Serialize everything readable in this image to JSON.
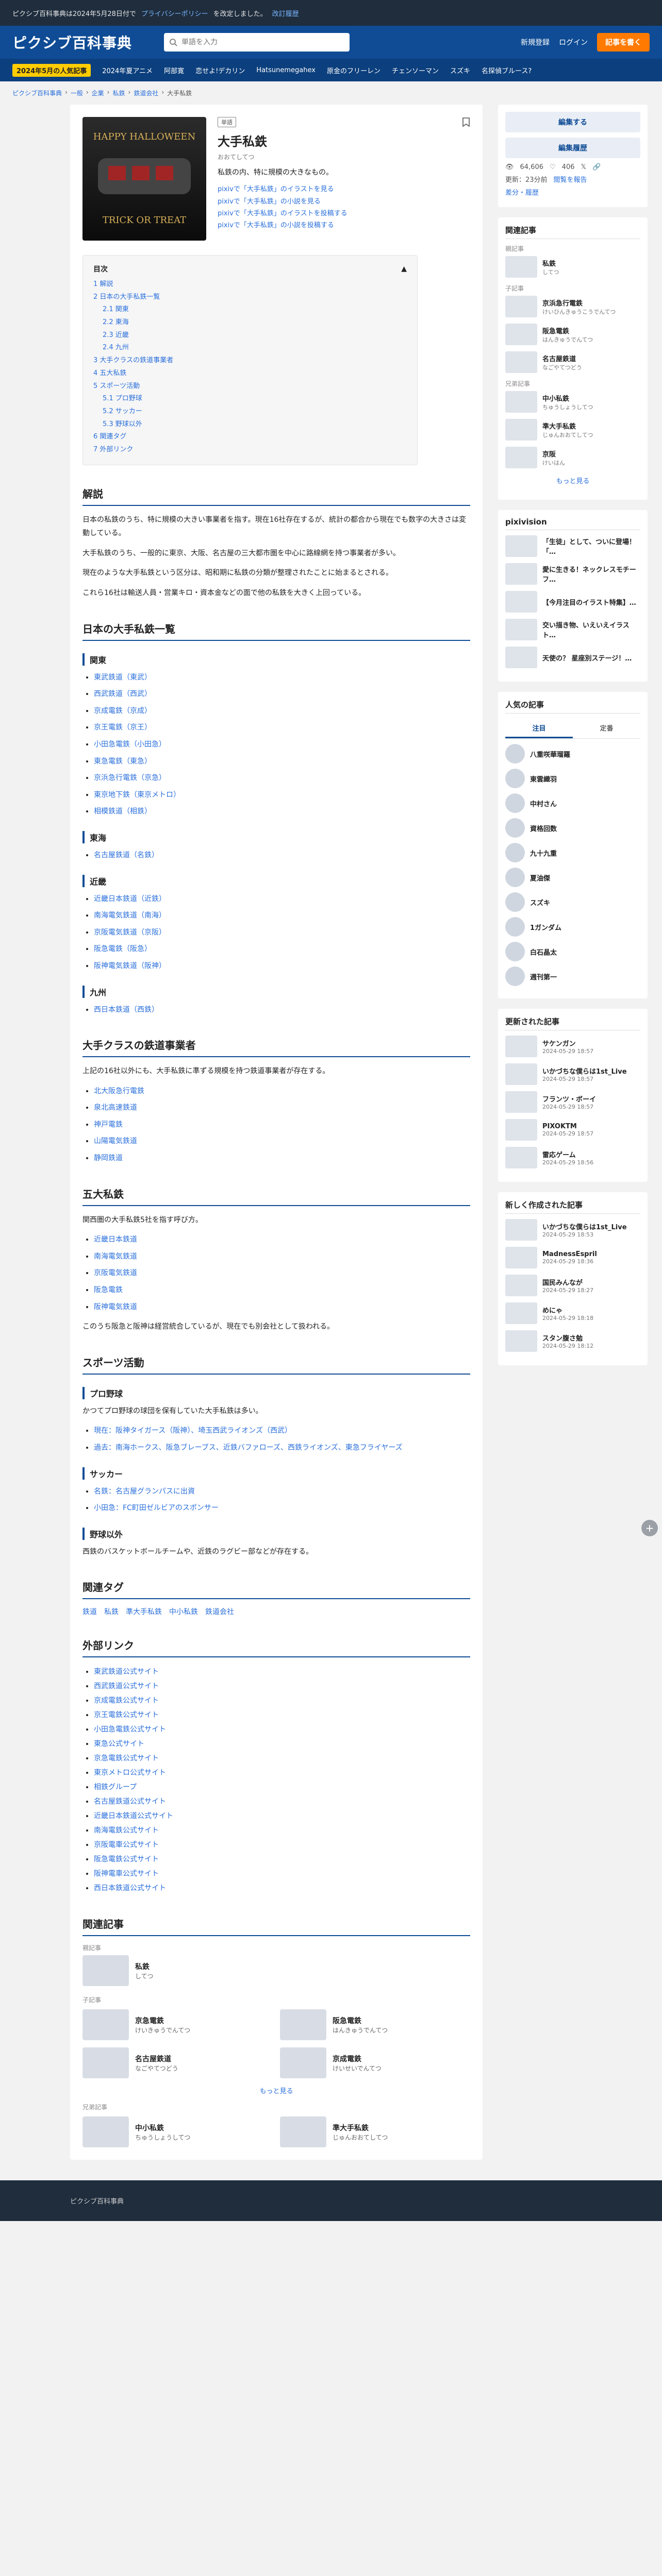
{
  "notice": {
    "text": "ピクシブ百科事典は2024年5月28日付で",
    "link": "プライバシーポリシー",
    "text2": "を改定しました。",
    "link2": "改訂履歴"
  },
  "header": {
    "logo": "ピクシブ百科事典",
    "search_placeholder": "単語を入力",
    "links": [
      "新規登録",
      "ログイン"
    ],
    "cta": "記事を書く",
    "trend_tag": "2024年5月の人気記事",
    "trends": [
      "2024年夏アニメ",
      "阿部寛",
      "恋せよ!デカリン",
      "Hatsunemegahex",
      "原金のフリーレン",
      "チェンソーマン",
      "スズキ",
      "名探偵ブルース?"
    ]
  },
  "breadcrumb": [
    "ピクシブ百科事典",
    "一般",
    "企業",
    "私鉄",
    "鉄道会社",
    "大手私鉄"
  ],
  "article": {
    "badge": "単語",
    "title": "大手私鉄",
    "reading": "おおてしてつ",
    "lead": "私鉄の内、特に規模の大きなもの。",
    "pixiv_links": [
      "pixivで「大手私鉄」のイラストを見る",
      "pixivで「大手私鉄」の小説を見る",
      "pixivで「大手私鉄」のイラストを投稿する",
      "pixivで「大手私鉄」の小説を投稿する"
    ],
    "thumb_text_top": "HAPPY HALLOWEEN",
    "thumb_text_bottom": "TRICK OR TREAT"
  },
  "toc": {
    "heading": "目次",
    "items": [
      {
        "label": "1 解説",
        "sub": false
      },
      {
        "label": "2 日本の大手私鉄一覧",
        "sub": false
      },
      {
        "label": "2.1 関東",
        "sub": true
      },
      {
        "label": "2.2 東海",
        "sub": true
      },
      {
        "label": "2.3 近畿",
        "sub": true
      },
      {
        "label": "2.4 九州",
        "sub": true
      },
      {
        "label": "3 大手クラスの鉄道事業者",
        "sub": false
      },
      {
        "label": "4 五大私鉄",
        "sub": false
      },
      {
        "label": "5 スポーツ活動",
        "sub": false
      },
      {
        "label": "5.1 プロ野球",
        "sub": true
      },
      {
        "label": "5.2 サッカー",
        "sub": true
      },
      {
        "label": "5.3 野球以外",
        "sub": true
      },
      {
        "label": "6 関連タグ",
        "sub": false
      },
      {
        "label": "7 外部リンク",
        "sub": false
      }
    ]
  },
  "sections": {
    "kaisetsu": {
      "title": "解説",
      "paras": [
        "日本の私鉄のうち、特に規模の大きい事業者を指す。現在16社存在するが、統計の都合から現在でも数字の大きさは変動している。",
        "大手私鉄のうち、一般的に東京、大阪、名古屋の三大都市圏を中心に路線網を持つ事業者が多い。",
        "現在のような大手私鉄という区分は、昭和期に私鉄の分類が整理されたことに始まるとされる。",
        "これら16社は輸送人員・営業キロ・資本金などの面で他の私鉄を大きく上回っている。"
      ]
    },
    "list": {
      "title": "日本の大手私鉄一覧",
      "kanto_title": "関東",
      "kanto": [
        "東武鉄道（東武）",
        "西武鉄道（西武）",
        "京成電鉄（京成）",
        "京王電鉄（京王）",
        "小田急電鉄（小田急）",
        "東急電鉄（東急）",
        "京浜急行電鉄（京急）",
        "東京地下鉄（東京メトロ）",
        "相模鉄道（相鉄）"
      ],
      "tokai_title": "東海",
      "tokai": [
        "名古屋鉄道（名鉄）"
      ],
      "kinki_title": "近畿",
      "kinki": [
        "近畿日本鉄道（近鉄）",
        "南海電気鉄道（南海）",
        "京阪電気鉄道（京阪）",
        "阪急電鉄（阪急）",
        "阪神電気鉄道（阪神）"
      ],
      "kyushu_title": "九州",
      "kyushu": [
        "西日本鉄道（西鉄）"
      ]
    },
    "class": {
      "title": "大手クラスの鉄道事業者",
      "para": "上記の16社以外にも、大手私鉄に準ずる規模を持つ鉄道事業者が存在する。",
      "items": [
        "北大阪急行電鉄",
        "泉北高速鉄道",
        "神戸電鉄",
        "山陽電気鉄道",
        "静岡鉄道"
      ]
    },
    "five": {
      "title": "五大私鉄",
      "para": "関西圏の大手私鉄5社を指す呼び方。",
      "items": [
        "近畿日本鉄道",
        "南海電気鉄道",
        "京阪電気鉄道",
        "阪急電鉄",
        "阪神電気鉄道"
      ],
      "note": "このうち阪急と阪神は経営統合しているが、現在でも別会社として扱われる。"
    },
    "sports": {
      "title": "スポーツ活動",
      "baseball_title": "プロ野球",
      "baseball_para": "かつてプロ野球の球団を保有していた大手私鉄は多い。",
      "baseball_items": [
        "現在：阪神タイガース（阪神）、埼玉西武ライオンズ（西武）",
        "過去：南海ホークス、阪急ブレーブス、近鉄バファローズ、西鉄ライオンズ、東急フライヤーズ"
      ],
      "soccer_title": "サッカー",
      "soccer_items": [
        "名鉄：名古屋グランパスに出資",
        "小田急：FC町田ゼルビアのスポンサー"
      ],
      "other_title": "野球以外",
      "other_para": "西鉄のバスケットボールチームや、近鉄のラグビー部などが存在する。"
    },
    "tags": {
      "title": "関連タグ",
      "items": [
        "鉄道",
        "私鉄",
        "準大手私鉄",
        "中小私鉄",
        "鉄道会社"
      ]
    },
    "links": {
      "title": "外部リンク",
      "items": [
        "東武鉄道公式サイト",
        "西武鉄道公式サイト",
        "京成電鉄公式サイト",
        "京王電鉄公式サイト",
        "小田急電鉄公式サイト",
        "東急公式サイト",
        "京急電鉄公式サイト",
        "東京メトロ公式サイト",
        "相鉄グループ",
        "名古屋鉄道公式サイト",
        "近畿日本鉄道公式サイト",
        "南海電鉄公式サイト",
        "京阪電車公式サイト",
        "阪急電鉄公式サイト",
        "阪神電車公式サイト",
        "西日本鉄道公式サイト"
      ]
    }
  },
  "related_bottom": {
    "title": "関連記事",
    "sub": "親記事",
    "parent": {
      "name": "私鉄",
      "desc": "してつ"
    },
    "children_title": "子記事",
    "children": [
      {
        "name": "京急電鉄",
        "desc": "けいきゅうでんてつ"
      },
      {
        "name": "阪急電鉄",
        "desc": "はんきゅうでんてつ"
      },
      {
        "name": "名古屋鉄道",
        "desc": "なごやてつどう"
      },
      {
        "name": "京成電鉄",
        "desc": "けいせいでんてつ"
      }
    ],
    "more": "もっと見る",
    "sibling_title": "兄弟記事",
    "siblings": [
      {
        "name": "中小私鉄",
        "desc": "ちゅうしょうしてつ"
      },
      {
        "name": "準大手私鉄",
        "desc": "じゅんおおてしてつ"
      }
    ]
  },
  "sidebar": {
    "edit": "編集する",
    "edit_log": "編集履歴",
    "views": "64,606",
    "likes": "406",
    "updated": "更新：23分前",
    "diff": "閲覧を報告",
    "history_link": "差分・履歴",
    "related_title": "関連記事",
    "parent_label": "親記事",
    "parent": {
      "title": "私鉄",
      "sub": "してつ"
    },
    "children_label": "子記事",
    "children": [
      {
        "title": "京浜急行電鉄",
        "sub": "けいひんきゅうこうでんてつ"
      },
      {
        "title": "阪急電鉄",
        "sub": "はんきゅうでんてつ"
      },
      {
        "title": "名古屋鉄道",
        "sub": "なごやてつどう"
      }
    ],
    "siblings_label": "兄弟記事",
    "siblings": [
      {
        "title": "中小私鉄",
        "sub": "ちゅうしょうしてつ"
      },
      {
        "title": "準大手私鉄",
        "sub": "じゅんおおてしてつ"
      },
      {
        "title": "京阪",
        "sub": "けいはん"
      }
    ],
    "more": "もっと見る",
    "pixivision_title": "pixivision",
    "pixivision": [
      "「生徒」として、ついに登場！「…",
      "愛に生きる！ネックレスモチーフ…",
      "【今月注目のイラスト特集】…",
      "交い描き物、いえいえイラスト…",
      "天使の？ 星座別ステージ！…"
    ],
    "popular_title": "人気の記事",
    "tab_trending": "注目",
    "tab_fixed": "定番",
    "popular": [
      "八重咲華瑠羅",
      "東雲織羽",
      "中村さん",
      "資格回数",
      "九十九重",
      "夏油傑",
      "スズキ",
      "1ガンダム",
      "白石晶太",
      "週刊第一"
    ],
    "updated_title": "更新された記事",
    "updated_items": [
      {
        "title": "サケンガン",
        "sub": "2024-05-29 18:57"
      },
      {
        "title": "いかづちな僕らは1st_Live",
        "sub": "2024-05-29 18:57"
      },
      {
        "title": "フランツ・ボーイ",
        "sub": "2024-05-29 18:57"
      },
      {
        "title": "PIXOKTM",
        "sub": "2024-05-29 18:57"
      },
      {
        "title": "雷応ゲーム",
        "sub": "2024-05-29 18:56"
      }
    ],
    "new_title": "新しく作成された記事",
    "new_items": [
      {
        "title": "いかづちな僕らは1st_Live",
        "sub": "2024-05-29 18:53"
      },
      {
        "title": "MadnessEspril",
        "sub": "2024-05-29 18:36"
      },
      {
        "title": "国民みんなが",
        "sub": "2024-05-29 18:27"
      },
      {
        "title": "めにゃ",
        "sub": "2024-05-29 18:18"
      },
      {
        "title": "スタン腹さ勉",
        "sub": "2024-05-29 18:12"
      }
    ]
  },
  "footer": {
    "text": "ピクシブ百科事典"
  },
  "colors": {
    "brand": "#0f4c95",
    "accent": "#ff7a00",
    "link": "#2a6fdb"
  }
}
